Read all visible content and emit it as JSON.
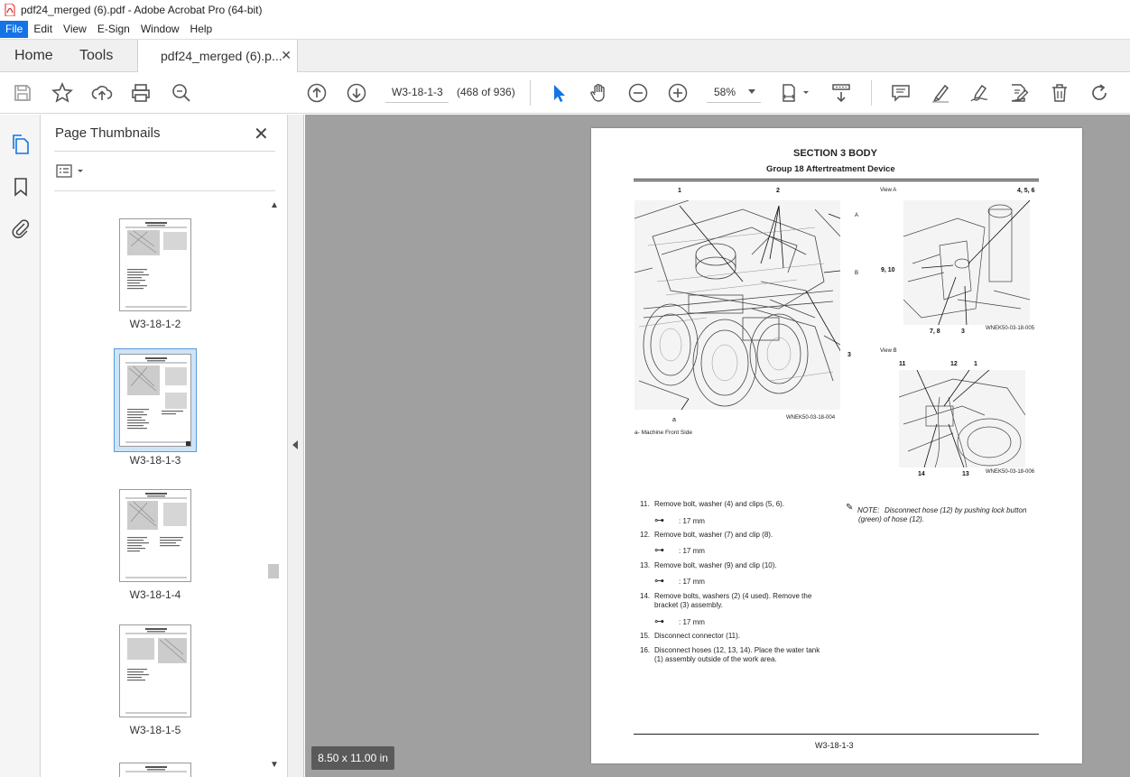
{
  "window": {
    "title": "pdf24_merged (6).pdf - Adobe Acrobat Pro (64-bit)"
  },
  "menu": [
    "File",
    "Edit",
    "View",
    "E-Sign",
    "Window",
    "Help"
  ],
  "tabs": {
    "home": "Home",
    "tools": "Tools",
    "document": "pdf24_merged (6).p..."
  },
  "toolbar": {
    "page_value": "W3-18-1-3",
    "page_count": "(468 of 936)",
    "zoom": "58%"
  },
  "thumbnails": {
    "title": "Page Thumbnails",
    "items": [
      {
        "label": "W3-18-1-2",
        "selected": false
      },
      {
        "label": "W3-18-1-3",
        "selected": true
      },
      {
        "label": "W3-18-1-4",
        "selected": false
      },
      {
        "label": "W3-18-1-5",
        "selected": false
      }
    ]
  },
  "viewer": {
    "page_size": "8.50 x 11.00 in"
  },
  "document": {
    "section": "SECTION 3 BODY",
    "group": "Group 18 Aftertreatment Device",
    "view_a": "View A",
    "view_b": "View B",
    "fig1_code": "WNEK50-03-18-004",
    "fig2_code": "WNEK50-03-18-005",
    "fig3_code": "WNEK50-03-18-006",
    "legend": "a-     Machine Front Side",
    "callouts_main": [
      "1",
      "2",
      "A",
      "B",
      "3",
      "a"
    ],
    "callouts_a": [
      "4, 5, 6",
      "9, 10",
      "7, 8",
      "3"
    ],
    "callouts_b": [
      "11",
      "12",
      "1",
      "14",
      "13"
    ],
    "steps": [
      {
        "num": "11.",
        "text": "Remove bolt, washer (4) and clips (5, 6).",
        "torque": ": 17 mm"
      },
      {
        "num": "12.",
        "text": "Remove bolt, washer (7) and clip (8).",
        "torque": ": 17 mm"
      },
      {
        "num": "13.",
        "text": "Remove bolt, washer (9) and clip (10).",
        "torque": ": 17 mm"
      },
      {
        "num": "14.",
        "text": "Remove bolts, washers (2) (4 used). Remove the",
        "text2": "bracket (3) assembly.",
        "torque": ": 17 mm"
      },
      {
        "num": "15.",
        "text": "Disconnect connector (11)."
      },
      {
        "num": "16.",
        "text": "Disconnect hoses (12, 13, 14). Place the water tank",
        "text2": "(1) assembly outside of the work area."
      }
    ],
    "note_label": "NOTE:",
    "note_text": "Disconnect hose (12) by pushing lock button",
    "note_text2": "(green) of hose (12).",
    "footer": "W3-18-1-3"
  }
}
